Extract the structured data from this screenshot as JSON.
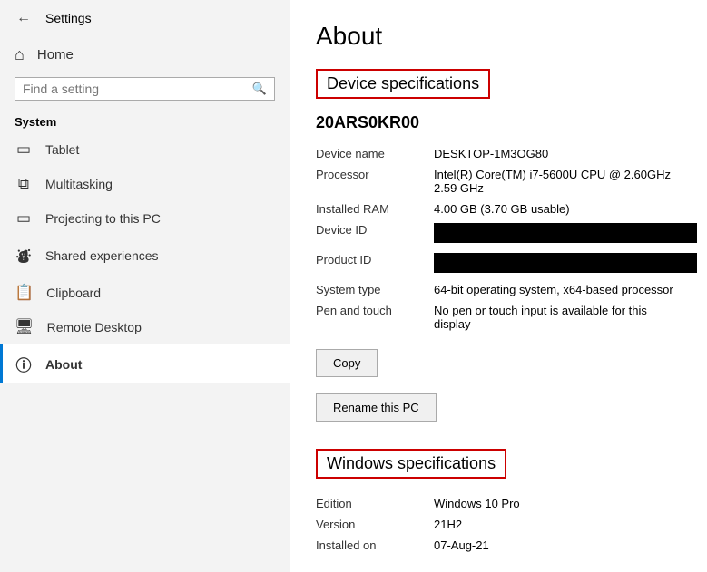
{
  "titlebar": {
    "title": "Settings"
  },
  "sidebar": {
    "home_label": "Home",
    "search_placeholder": "Find a setting",
    "section_label": "System",
    "items": [
      {
        "id": "tablet",
        "label": "Tablet",
        "icon": "▭"
      },
      {
        "id": "multitasking",
        "label": "Multitasking",
        "icon": "⧉"
      },
      {
        "id": "projecting",
        "label": "Projecting to this PC",
        "icon": "⊡"
      },
      {
        "id": "shared",
        "label": "Shared experiences",
        "icon": "⚇"
      },
      {
        "id": "clipboard",
        "label": "Clipboard",
        "icon": "📋"
      },
      {
        "id": "remote",
        "label": "Remote Desktop",
        "icon": "🖥"
      },
      {
        "id": "about",
        "label": "About",
        "icon": "ℹ"
      }
    ]
  },
  "main": {
    "page_title": "About",
    "device_specs_header": "Device specifications",
    "device_name": "20ARS0KR00",
    "specs": [
      {
        "label": "Device name",
        "value": "DESKTOP-1M3OG80",
        "redacted": false
      },
      {
        "label": "Processor",
        "value": "Intel(R) Core(TM) i7-5600U CPU @ 2.60GHz   2.59 GHz",
        "redacted": false
      },
      {
        "label": "Installed RAM",
        "value": "4.00 GB (3.70 GB usable)",
        "redacted": false
      },
      {
        "label": "Device ID",
        "value": "",
        "redacted": true
      },
      {
        "label": "Product ID",
        "value": "",
        "redacted": true
      },
      {
        "label": "System type",
        "value": "64-bit operating system, x64-based processor",
        "redacted": false
      },
      {
        "label": "Pen and touch",
        "value": "No pen or touch input is available for this display",
        "redacted": false
      }
    ],
    "copy_button": "Copy",
    "rename_button": "Rename this PC",
    "windows_specs_header": "Windows specifications",
    "win_specs": [
      {
        "label": "Edition",
        "value": "Windows 10 Pro"
      },
      {
        "label": "Version",
        "value": "21H2"
      },
      {
        "label": "Installed on",
        "value": "07-Aug-21"
      }
    ]
  }
}
